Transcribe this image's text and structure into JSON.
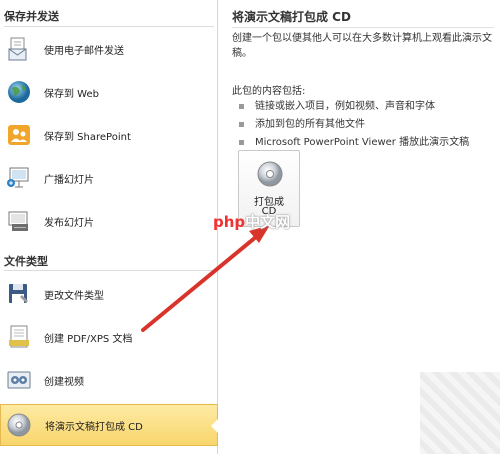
{
  "left": {
    "section_send": "保存并发送",
    "section_filetypes": "文件类型",
    "items": [
      {
        "label": "使用电子邮件发送",
        "icon": "email-icon"
      },
      {
        "label": "保存到 Web",
        "icon": "globe-icon"
      },
      {
        "label": "保存到 SharePoint",
        "icon": "sharepoint-icon"
      },
      {
        "label": "广播幻灯片",
        "icon": "broadcast-icon"
      },
      {
        "label": "发布幻灯片",
        "icon": "publish-slides-icon"
      },
      {
        "label": "更改文件类型",
        "icon": "save-disk-icon"
      },
      {
        "label": "创建 PDF/XPS 文档",
        "icon": "pdf-document-icon"
      },
      {
        "label": "创建视频",
        "icon": "video-icon"
      },
      {
        "label": "将演示文稿打包成 CD",
        "icon": "cd-icon",
        "selected": true
      }
    ]
  },
  "right": {
    "title": "将演示文稿打包成 CD",
    "description": "创建一个包以便其他人可以在大多数计算机上观看此演示文稿。",
    "contents_title": "此包的内容包括:",
    "bullets": [
      "链接或嵌入项目，例如视频、声音和字体",
      "添加到包的所有其他文件",
      "Microsoft PowerPoint Viewer 播放此演示文稿"
    ],
    "button_label_line1": "打包成",
    "button_label_line2": "CD"
  },
  "watermark": {
    "part1": "php",
    "part2": "中文网"
  },
  "colors": {
    "selected_bg": "#f9d66c",
    "arrow": "#d9342b"
  }
}
